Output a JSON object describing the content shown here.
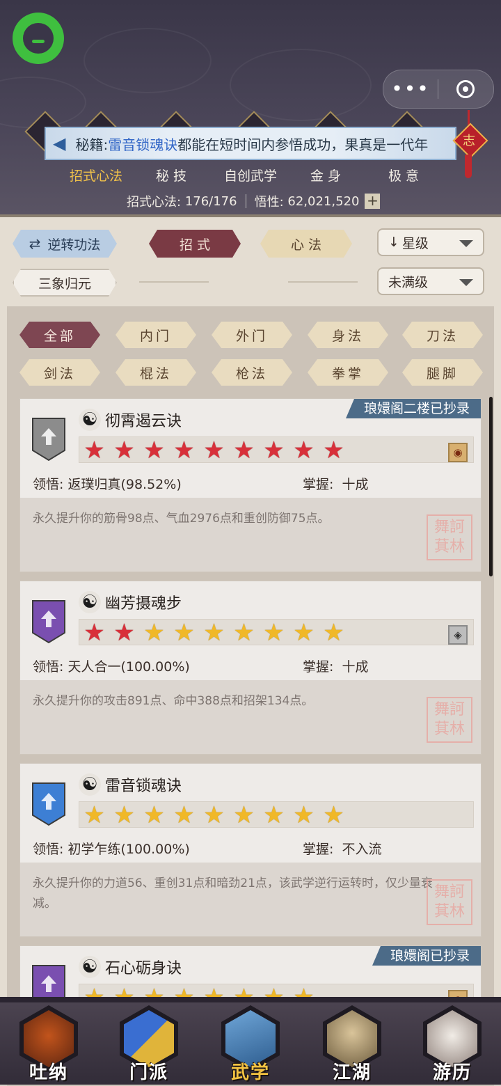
{
  "header": {
    "notice": {
      "prefix": "秘籍:",
      "highlight": "雷音锁魂诀",
      "rest": "都能在短时间内参悟成功，果真是一代年"
    },
    "knot_char": "志",
    "capsule": {
      "more": "•••"
    },
    "categories": [
      "招式心法",
      "秘 技",
      "自创武学",
      "金 身",
      "极 意"
    ],
    "active_category": "招式心法",
    "stats": {
      "skills_label": "招式心法:",
      "skills_value": "176/176",
      "insight_label": "悟性:",
      "insight_value": "62,021,520",
      "plus": "+"
    }
  },
  "controls": {
    "reverse_label": "逆转功法",
    "tab_moves": "招 式",
    "tab_mind": "心 法",
    "sort_label": "星级",
    "sanxiang_label": "三象归元",
    "level_filter": "未满级"
  },
  "filters": [
    "全部",
    "内门",
    "外门",
    "身法",
    "刀法",
    "剑法",
    "棍法",
    "枪法",
    "拳掌",
    "腿脚"
  ],
  "active_filter": "全部",
  "cards": [
    {
      "name": "彻霄遏云诀",
      "tag": "琅嬛阁二楼已抄录",
      "badge_color": "#8c8c8c",
      "stars_red": 9,
      "stars_gold": 0,
      "icon": "◉",
      "comprehension_label": "领悟:",
      "comprehension": "返璞归真(98.52%)",
      "mastery_label": "掌握:",
      "mastery": "十成",
      "desc": "永久提升你的筋骨98点、气血2976点和重创防御75点。",
      "seal": "舞訶萁林"
    },
    {
      "name": "幽芳摄魂步",
      "tag": "",
      "badge_color": "#7a4fb0",
      "stars_red": 2,
      "stars_gold": 7,
      "icon": "◈",
      "comprehension_label": "领悟:",
      "comprehension": "天人合一(100.00%)",
      "mastery_label": "掌握:",
      "mastery": "十成",
      "desc": "永久提升你的攻击891点、命中388点和招架134点。",
      "seal": "舞訶萁林"
    },
    {
      "name": "雷音锁魂诀",
      "tag": "",
      "badge_color": "#3d7fd4",
      "stars_red": 0,
      "stars_gold": 9,
      "icon": "",
      "comprehension_label": "领悟:",
      "comprehension": "初学乍练(100.00%)",
      "mastery_label": "掌握:",
      "mastery": "不入流",
      "desc": "永久提升你的力道56、重创31点和暗劲21点，该武学逆行运转时，仅少量衰减。",
      "seal": "舞訶萁林"
    },
    {
      "name": "石心砺身诀",
      "tag": "琅嬛阁已抄录",
      "badge_color": "#7a4fb0",
      "stars_red": 0,
      "stars_gold": 8,
      "icon": "◉",
      "comprehension_label": "",
      "comprehension": "",
      "mastery_label": "",
      "mastery": "",
      "desc": "",
      "seal": ""
    }
  ],
  "nav": [
    "吐纳",
    "门派",
    "武学",
    "江湖",
    "游历"
  ],
  "active_nav": "武学",
  "colors": {
    "accent_gold": "#f1c24a",
    "tab_red": "#7a3a44",
    "notice_blue": "#2f64c6"
  }
}
